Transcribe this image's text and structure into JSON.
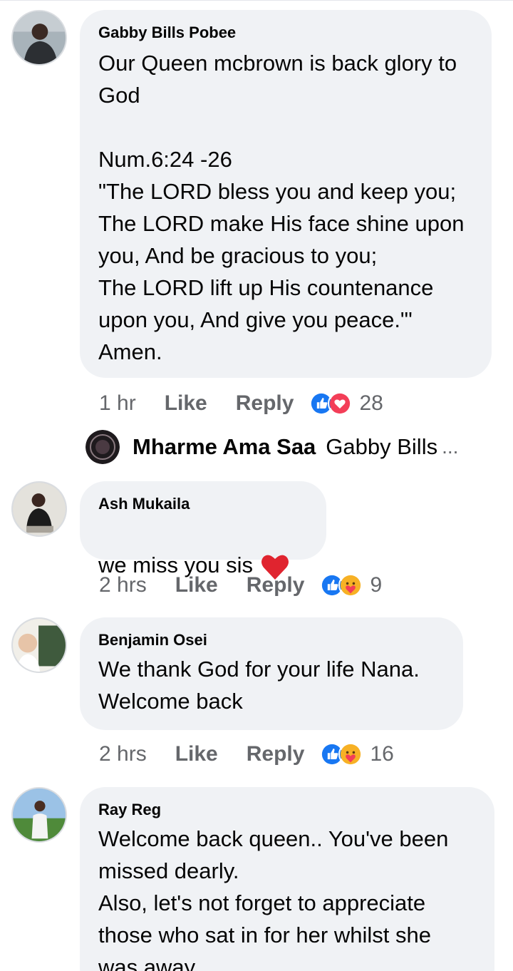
{
  "comments": [
    {
      "author": "Gabby Bills Pobee",
      "text": "Our Queen mcbrown is back glory to God\n\nNum.6:24 -26\n\"The LORD bless you and keep you;\nThe LORD make His face shine upon you, And be gracious to you;\nThe LORD lift up His countenance upon you, And give you peace.\"'\nAmen.",
      "time": "1 hr",
      "like_label": "Like",
      "reply_label": "Reply",
      "reactions": [
        "like-icon",
        "love-icon"
      ],
      "reaction_count": "28"
    },
    {
      "author": "Ash Mukaila",
      "text": "we miss you sis",
      "emoji": "red-heart-emoji",
      "time": "2 hrs",
      "like_label": "Like",
      "reply_label": "Reply",
      "reactions": [
        "like-icon",
        "care-icon"
      ],
      "reaction_count": "9"
    },
    {
      "author": "Benjamin Osei",
      "text": "We thank God for your life Nana.\nWelcome back",
      "time": "2 hrs",
      "like_label": "Like",
      "reply_label": "Reply",
      "reactions": [
        "like-icon",
        "care-icon"
      ],
      "reaction_count": "16"
    },
    {
      "author": "Ray Reg",
      "text": "Welcome back queen.. You've been missed dearly.\nAlso, let's not forget to appreciate those who sat in for her whilst she was away"
    }
  ],
  "reply_preview": {
    "name": "Mharme Ama Saa",
    "preview": "Gabby Bills",
    "ellipsis": "..."
  },
  "colors": {
    "bubble": "#f0f2f5",
    "meta_text": "#65676b",
    "like_blue": "#1877f2",
    "love_red": "#f33e58",
    "care_yellow": "#f7b125"
  }
}
